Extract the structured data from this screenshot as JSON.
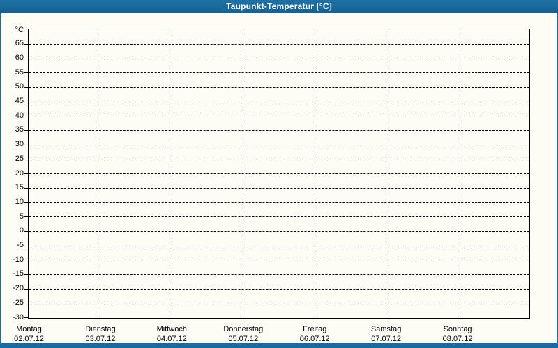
{
  "window": {
    "title": "Taupunkt-Temperatur [°C]"
  },
  "colors": {
    "frame_blue": "#1b699d",
    "canvas_background": "#fdfdf6",
    "grid_line": "#000000",
    "title_text": "#ffffff"
  },
  "chart_data": {
    "type": "line",
    "title": "Taupunkt-Temperatur [°C]",
    "xlabel": "",
    "ylabel": "°C",
    "ylim": [
      -30,
      70
    ],
    "y_tick_step": 5,
    "y_tick_labels": [
      65,
      60,
      55,
      50,
      45,
      40,
      35,
      30,
      25,
      20,
      15,
      10,
      5,
      0,
      -5,
      -10,
      -15,
      -20,
      -25,
      -30
    ],
    "x_intervals": 7,
    "x_categories": [
      {
        "weekday": "Montag",
        "date": "02.07.12"
      },
      {
        "weekday": "Dienstag",
        "date": "03.07.12"
      },
      {
        "weekday": "Mittwoch",
        "date": "04.07.12"
      },
      {
        "weekday": "Donnerstag",
        "date": "05.07.12"
      },
      {
        "weekday": "Freitag",
        "date": "06.07.12"
      },
      {
        "weekday": "Samstag",
        "date": "07.07.12"
      },
      {
        "weekday": "Sonntag",
        "date": "08.07.12"
      }
    ],
    "grid": true,
    "legend": null,
    "series": []
  }
}
